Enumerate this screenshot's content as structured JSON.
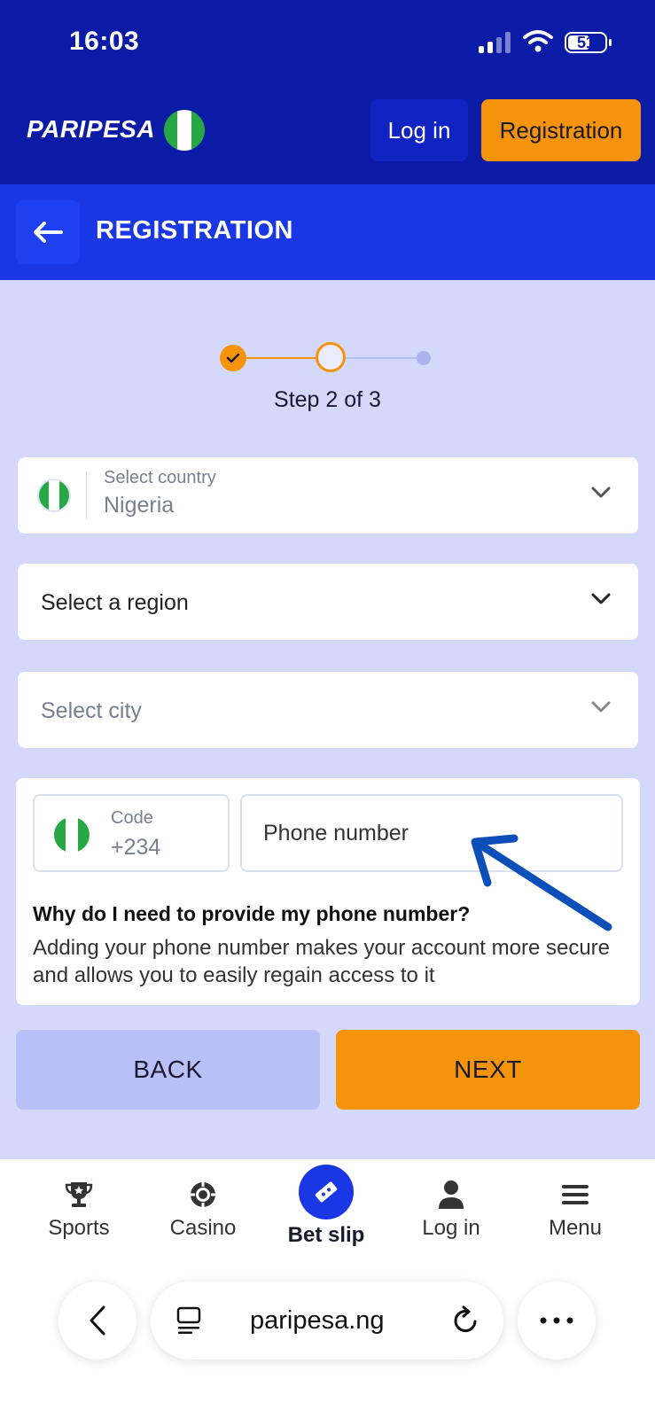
{
  "status_bar": {
    "time": "16:03",
    "battery": "51"
  },
  "header": {
    "logo": "PARIPESA",
    "login_label": "Log in",
    "registration_label": "Registration"
  },
  "title_bar": {
    "title": "REGISTRATION"
  },
  "stepper": {
    "current_step": 2,
    "total_steps": 3,
    "label": "Step 2 of 3"
  },
  "form": {
    "country": {
      "label": "Select country",
      "value": "Nigeria"
    },
    "region": {
      "placeholder": "Select a region"
    },
    "city": {
      "placeholder": "Select city"
    },
    "phone": {
      "code_label": "Code",
      "code_value": "+234",
      "number_placeholder": "Phone number",
      "why_title": "Why do I need to provide my phone number?",
      "why_text": "Adding your phone number makes your account more secure and allows you to easily regain access to it"
    },
    "back_label": "BACK",
    "next_label": "NEXT"
  },
  "bottom_nav": {
    "items": [
      {
        "label": "Sports",
        "icon": "trophy-icon"
      },
      {
        "label": "Casino",
        "icon": "casino-chip-icon"
      },
      {
        "label": "Bet slip",
        "icon": "ticket-icon"
      },
      {
        "label": "Log in",
        "icon": "user-icon"
      },
      {
        "label": "Menu",
        "icon": "hamburger-icon"
      }
    ]
  },
  "browser": {
    "url": "paripesa.ng"
  },
  "colors": {
    "header_bg": "#0a1ba6",
    "title_bar_bg": "#1a37e6",
    "accent_orange": "#f5930a",
    "page_bg": "#d4d9fb",
    "annotation_arrow": "#0d4fb8"
  }
}
